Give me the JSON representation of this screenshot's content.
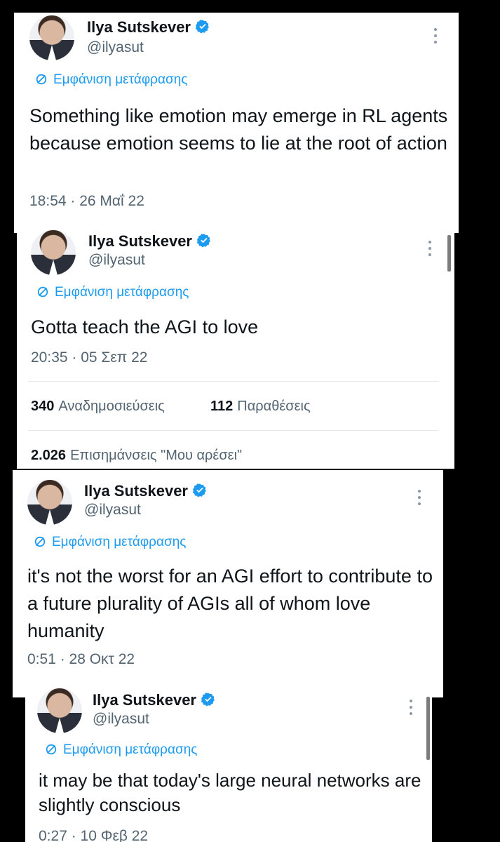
{
  "tweets": [
    {
      "name": "Ilya Sutskever",
      "handle": "@ilyasut",
      "translate_label": "Εμφάνιση μετάφρασης",
      "text": "Something like emotion may emerge in RL agents because emotion seems to lie at the root of action",
      "time": "18:54 · 26 Μαΐ 22"
    },
    {
      "name": "Ilya Sutskever",
      "handle": "@ilyasut",
      "translate_label": "Εμφάνιση μετάφρασης",
      "text": "Gotta teach the AGI to love",
      "time": "20:35 · 05 Σεπ 22",
      "stats": {
        "reposts_count": "340",
        "reposts_label": "Αναδημοσιεύσεις",
        "quotes_count": "112",
        "quotes_label": "Παραθέσεις",
        "likes_count": "2.026",
        "likes_label": "Επισημάνσεις \"Μου αρέσει\""
      }
    },
    {
      "name": "Ilya Sutskever",
      "handle": "@ilyasut",
      "translate_label": "Εμφάνιση μετάφρασης",
      "text": "it's not the worst for an AGI effort to contribute to a future plurality of AGIs all of whom love humanity",
      "time": "0:51 · 28 Οκτ 22"
    },
    {
      "name": "Ilya Sutskever",
      "handle": "@ilyasut",
      "translate_label": "Εμφάνιση μετάφρασης",
      "text": "it may be that today's large neural networks are slightly conscious",
      "time": "0:27 · 10 Φεβ 22"
    }
  ],
  "colors": {
    "link": "#1d9bf0",
    "verified": "#1d9bf0",
    "secondary": "#536471",
    "primary": "#0f1419"
  },
  "icons": {
    "verified": "verified-badge-icon",
    "translate": "translate-globe-icon",
    "more": "more-options-icon"
  }
}
